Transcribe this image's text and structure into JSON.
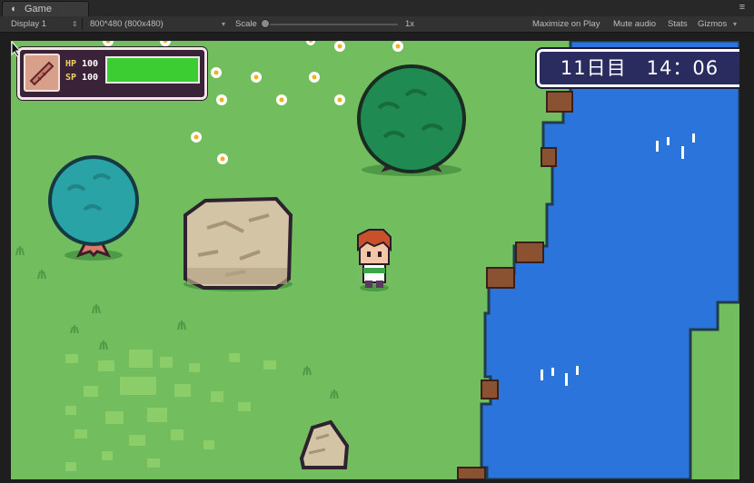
{
  "tab": {
    "title": "Game",
    "icon": "pacman-icon"
  },
  "toolbar": {
    "display": "Display 1",
    "resolution": "800*480 (800x480)",
    "scale_label": "Scale",
    "scale_value": "1x",
    "maximize": "Maximize on Play",
    "mute": "Mute audio",
    "stats": "Stats",
    "gizmos": "Gizmos"
  },
  "hud": {
    "hp_label": "HP",
    "hp_value": "100",
    "sp_label": "SP",
    "sp_value": "100",
    "hp_fill": 1.0,
    "weapon_icon": "wooden-club-icon",
    "bar_color": "#3ccd32"
  },
  "clock": {
    "text": "11日目　14：06"
  },
  "colors": {
    "grass": "#72bd5e",
    "water": "#2b74dc",
    "tree_green": "#1f8a52",
    "tree_teal": "#2aa3a6"
  }
}
